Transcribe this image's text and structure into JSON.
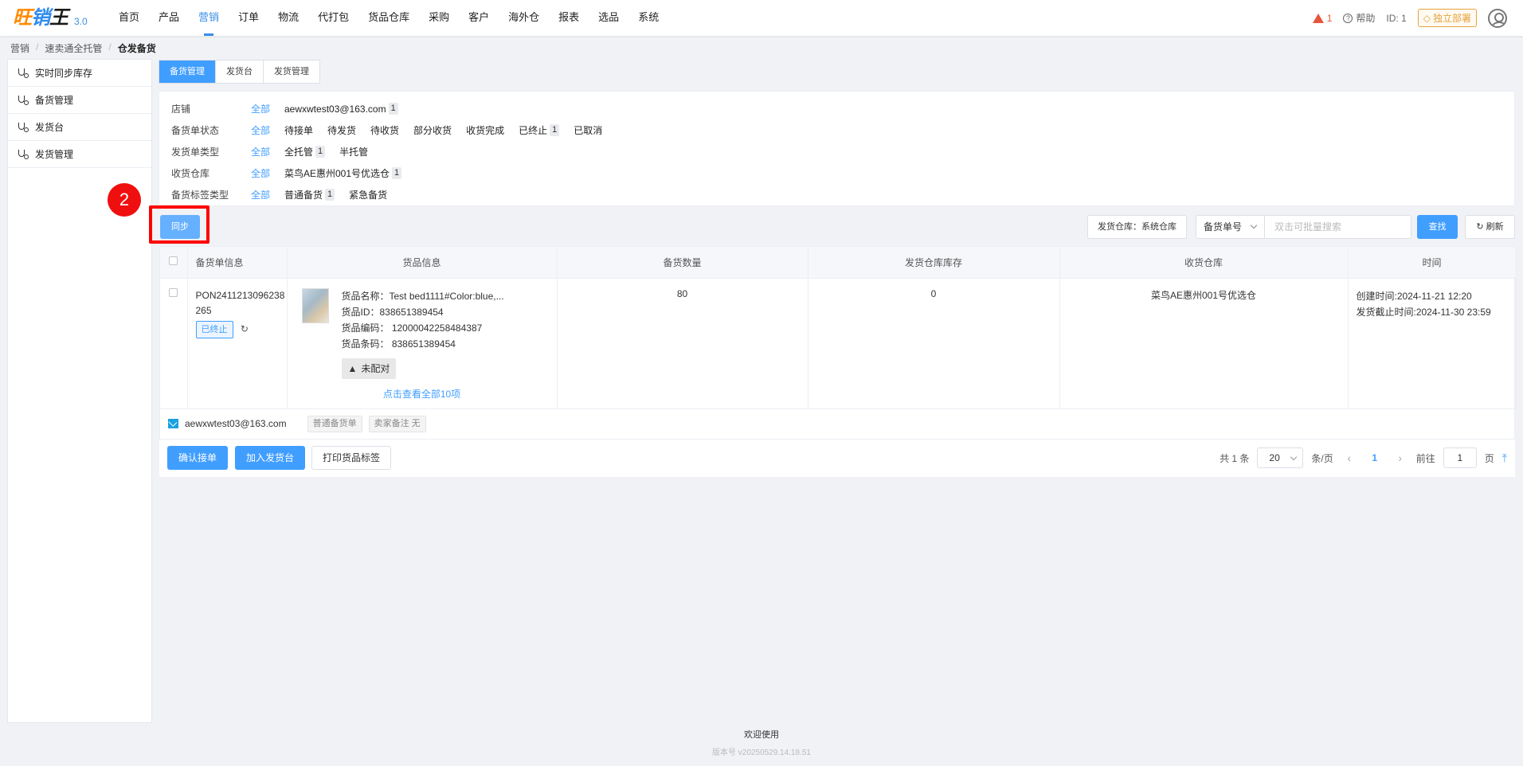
{
  "app": {
    "logo_text": "旺销王",
    "version": "3.0"
  },
  "nav": {
    "items": [
      "首页",
      "产品",
      "营销",
      "订单",
      "物流",
      "代打包",
      "货品仓库",
      "采购",
      "客户",
      "海外仓",
      "报表",
      "选品",
      "系统"
    ],
    "active": "营销"
  },
  "header_right": {
    "alert_count": "1",
    "help": "帮助",
    "id_text": "ID: 1",
    "deploy": "独立部署"
  },
  "breadcrumb": [
    "营销",
    "速卖通全托管",
    "仓发备货"
  ],
  "sidebar": {
    "items": [
      "实时同步库存",
      "备货管理",
      "发货台",
      "发货管理"
    ]
  },
  "step_badge": "2",
  "tabs": [
    "备货管理",
    "发货台",
    "发货管理"
  ],
  "filters": {
    "all_label": "全部",
    "rows": [
      {
        "label": "店铺",
        "options": [
          {
            "text": "aewxwtest03@163.com",
            "count": "1"
          }
        ]
      },
      {
        "label": "备货单状态",
        "options": [
          {
            "text": "待接单"
          },
          {
            "text": "待发货"
          },
          {
            "text": "待收货"
          },
          {
            "text": "部分收货"
          },
          {
            "text": "收货完成"
          },
          {
            "text": "已终止",
            "count": "1"
          },
          {
            "text": "已取消"
          }
        ]
      },
      {
        "label": "发货单类型",
        "options": [
          {
            "text": "全托管",
            "count": "1"
          },
          {
            "text": "半托管"
          }
        ]
      },
      {
        "label": "收货仓库",
        "options": [
          {
            "text": "菜鸟AE惠州001号优选仓",
            "count": "1"
          }
        ]
      },
      {
        "label": "备货标签类型",
        "options": [
          {
            "text": "普通备货",
            "count": "1"
          },
          {
            "text": "紧急备货"
          }
        ]
      }
    ]
  },
  "toolbar": {
    "sync": "同步",
    "warehouse_btn": "发货仓库：系统仓库",
    "search_field": "备货单号",
    "search_placeholder": "双击可批量搜索",
    "query": "查找",
    "refresh": "刷新"
  },
  "table": {
    "headers": [
      "备货单信息",
      "货品信息",
      "备货数量",
      "发货仓库库存",
      "收货仓库",
      "时间"
    ],
    "row": {
      "order_no": "PON2411213096238265",
      "status": "已终止",
      "goods_name": "货品名称：Test bed1111#Color:blue,...",
      "goods_id": "货品ID：838651389454",
      "goods_code": "货品编码：  12000042258484387",
      "goods_barcode": "货品条码：  838651389454",
      "unmatched": "未配对",
      "view_all": "点击查看全部10项",
      "qty": "80",
      "stock": "0",
      "receive_wh": "菜鸟AE惠州001号优选仓",
      "created": "创建时间:2024-11-21 12:20",
      "deadline": "发货截止时间:2024-11-30 23:59"
    },
    "shop_row": {
      "shop": "aewxwtest03@163.com",
      "tag1": "普通备货单",
      "tag2": "卖家备注 无"
    }
  },
  "bottom": {
    "confirm": "确认接单",
    "add_to_desk": "加入发货台",
    "print_labels": "打印货品标签"
  },
  "pager": {
    "total": "共 1 条",
    "page_size": "20",
    "per_page": "条/页",
    "current": "1",
    "goto": "前往",
    "goto_value": "1",
    "page_unit": "页"
  },
  "footer": {
    "welcome": "欢迎使用",
    "version": "版本号 v20250529.14.18.51"
  },
  "colors": {
    "primary": "#409eff",
    "danger": "#f00f0f",
    "warning": "#e6a23c"
  }
}
